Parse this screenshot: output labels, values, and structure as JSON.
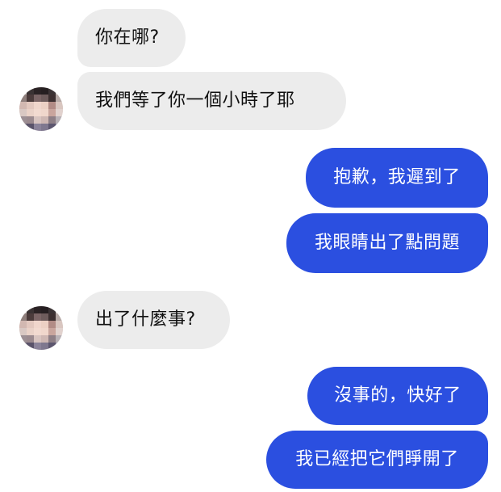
{
  "conversation": {
    "messages": [
      {
        "sender": "contact",
        "text": "你在哪?"
      },
      {
        "sender": "contact",
        "text": "我們等了你一個小時了耶"
      },
      {
        "sender": "me",
        "text": "抱歉，我遲到了"
      },
      {
        "sender": "me",
        "text": "我眼睛出了點問題"
      },
      {
        "sender": "contact",
        "text": "出了什麼事?"
      },
      {
        "sender": "me",
        "text": "沒事的，快好了"
      },
      {
        "sender": "me",
        "text": "我已經把它們睜開了"
      }
    ]
  },
  "colors": {
    "incoming_bubble": "#ececec",
    "outgoing_bubble": "#2b4fe0",
    "incoming_text": "#111111",
    "outgoing_text": "#ffffff"
  },
  "icons": {
    "contact_avatar": "pixelated-profile-photo"
  }
}
